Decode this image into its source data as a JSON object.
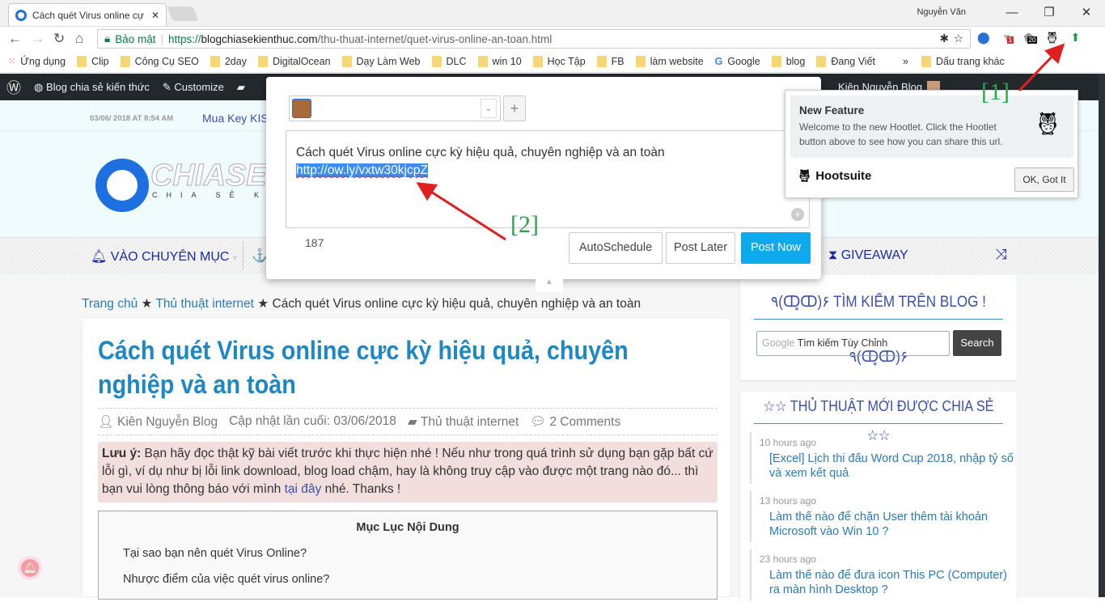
{
  "browser": {
    "tab_title": "Cách quét Virus online cự",
    "profile": "Nguyễn Văn",
    "security_label": "Bảo mật",
    "url_scheme": "https://",
    "url_host": "blogchiasekienthuc.com",
    "url_path": "/thu-thuat-internet/quet-virus-online-an-toan.html",
    "ext_badge_1": "1",
    "ext_badge_2": "20",
    "bookmarks": [
      "Ứng dụng",
      "Clip",
      "Công Cụ SEO",
      "2day",
      "DigitalOcean",
      "Dạy Làm Web",
      "DLC",
      "win 10",
      "Học Tập",
      "FB",
      "làm website",
      "Google",
      "blog",
      "Đang Viết"
    ],
    "bookmarks_more": "»",
    "other_bookmarks": "Dấu trang khác"
  },
  "wpbar": {
    "site": "Blog chia sẻ kiến thức",
    "customize": "Customize",
    "user": "Kiên Nguyễn Blog"
  },
  "site": {
    "date": "03/06/ 2018 AT 8:54 AM",
    "ticker": "Mua Key KIS",
    "logo_text": "CHIASEKIE",
    "logo_sub": "CHIA SẺ KI",
    "nav": [
      "VÀO CHUYÊN MỤC",
      "GIVEAWAY"
    ]
  },
  "breadcrumb": {
    "home": "Trang chủ",
    "category": "Thủ thuật internet",
    "current": "Cách quét Virus online cực kỳ hiệu quả, chuyên nghiệp và an toàn",
    "sep": "★"
  },
  "article": {
    "title": "Cách quét Virus online cực kỳ hiệu quả, chuyên nghiệp và an toàn",
    "author": "Kiên Nguyễn Blog",
    "updated": "Cập nhật lần cuối: 03/06/2018",
    "category": "Thủ thuật internet",
    "comments": "2 Comments",
    "note_label": "Lưu ý:",
    "note_text": " Bạn hãy đọc thật kỹ bài viết trước khi thực hiện nhé ! Nếu như trong quá trình sử dụng bạn gặp bất cứ lỗi gì, ví dụ như bị lỗi link download, blog load chậm, hay là không truy cập vào được một trang nào đó... thì bạn vui lòng thông báo với mình ",
    "note_link": "tại đây",
    "note_end": " nhé. Thanks !",
    "toc_title": "Mục Lục Nội Dung",
    "toc": [
      "Tại sao bạn nên quét Virus Online?",
      "Nhược điểm của việc quét virus online?"
    ]
  },
  "sidebar": {
    "search_title": "٩(ↀ̥ↀ)۶ TÌM KIẾM TRÊN BLOG ! ٩(ↀ̥ↀ)۶",
    "search_brand": "Google",
    "search_placeholder": "Tìm kiếm Tùy Chỉnh",
    "search_button": "Search",
    "recent_title": "☆☆ THỦ THUẬT MỚI ĐƯỢC CHIA SẺ ☆☆",
    "posts": [
      {
        "ago": "10 hours ago",
        "title": "[Excel] Lịch thi đấu Word Cup 2018, nhập tỷ số và xem kết quả"
      },
      {
        "ago": "13 hours ago",
        "title": "Làm thế nào để chặn User thêm tài khoản Microsoft vào Win 10 ?"
      },
      {
        "ago": "23 hours ago",
        "title": "Làm thế nào để đưa icon This PC (Computer) ra màn hình Desktop ?"
      }
    ]
  },
  "composer": {
    "text": "Cách quét Virus online cực kỳ hiệu quả, chuyên nghiệp và an toàn",
    "link": "http://ow.ly/vxtw30kjcpZ",
    "char_count": "187",
    "autoschedule": "AutoSchedule",
    "post_later": "Post Later",
    "post_now": "Post Now",
    "add_account": "+"
  },
  "hootlet": {
    "title": "New Feature",
    "body": "Welcome to the new Hootlet. Click the Hootlet button above to see how you can share this url.",
    "brand": "Hootsuite",
    "ok": "OK, Got It"
  },
  "annotations": {
    "one": "[1]",
    "two": "[2]"
  },
  "colors": {
    "accent": "#1e88c7",
    "post_now": "#0eaaee",
    "annotation": "#2aa44a",
    "arrow": "#e02020"
  }
}
